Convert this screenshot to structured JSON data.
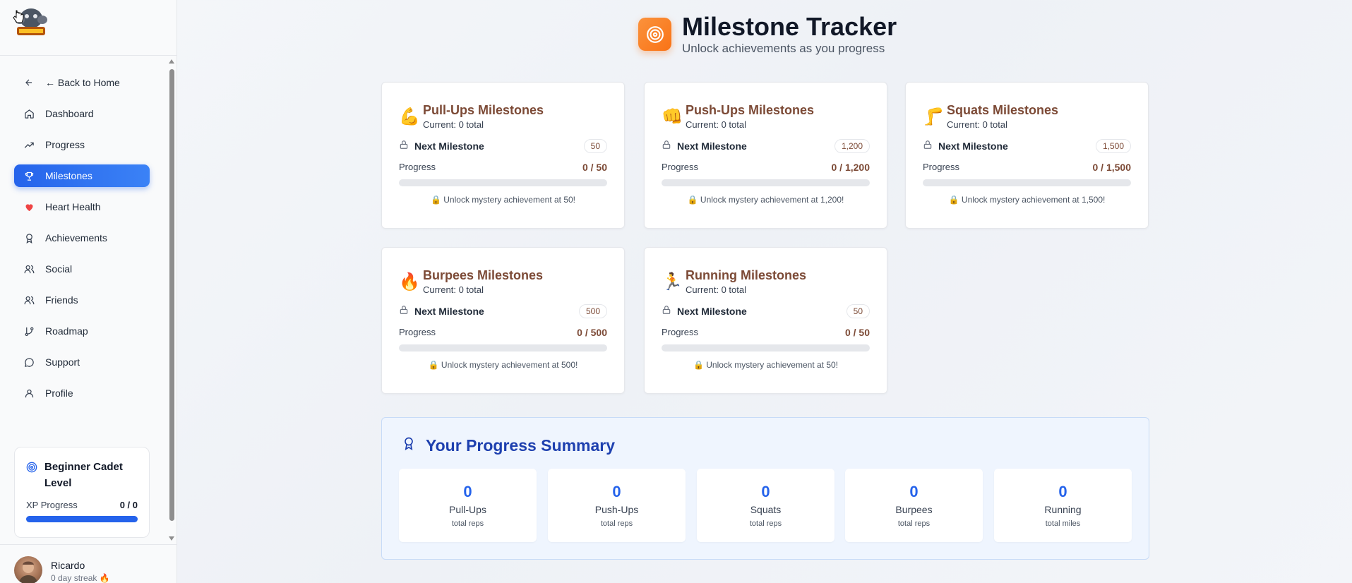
{
  "sidebar": {
    "items": [
      {
        "label": "← Back to Home",
        "icon": "arrow-left-icon"
      },
      {
        "label": "Dashboard",
        "icon": "home-icon"
      },
      {
        "label": "Progress",
        "icon": "trending-up-icon"
      },
      {
        "label": "Milestones",
        "icon": "trophy-icon"
      },
      {
        "label": "Heart Health",
        "icon": "heart-icon"
      },
      {
        "label": "Achievements",
        "icon": "award-icon"
      },
      {
        "label": "Social",
        "icon": "users-icon"
      },
      {
        "label": "Friends",
        "icon": "friends-icon"
      },
      {
        "label": "Roadmap",
        "icon": "git-branch-icon"
      },
      {
        "label": "Support",
        "icon": "message-circle-icon"
      },
      {
        "label": "Profile",
        "icon": "user-icon"
      }
    ],
    "active": "Milestones",
    "level": {
      "title": "Beginner Cadet Level",
      "xp_label": "XP Progress",
      "xp_value": "0 / 0"
    },
    "user": {
      "name": "Ricardo",
      "streak": "0 day streak 🔥"
    }
  },
  "header": {
    "title": "Milestone Tracker",
    "subtitle": "Unlock achievements as you progress"
  },
  "cards": [
    {
      "emoji": "💪",
      "title": "Pull-Ups Milestones",
      "current": "Current: 0 total",
      "next_label": "Next Milestone",
      "next_value": "50",
      "progress_label": "Progress",
      "progress_value": "0 / 50",
      "unlock": "🔒 Unlock mystery achievement at 50!"
    },
    {
      "emoji": "👊",
      "title": "Push-Ups Milestones",
      "current": "Current: 0 total",
      "next_label": "Next Milestone",
      "next_value": "1,200",
      "progress_label": "Progress",
      "progress_value": "0 / 1,200",
      "unlock": "🔒 Unlock mystery achievement at 1,200!"
    },
    {
      "emoji": "🦵",
      "title": "Squats Milestones",
      "current": "Current: 0 total",
      "next_label": "Next Milestone",
      "next_value": "1,500",
      "progress_label": "Progress",
      "progress_value": "0 / 1,500",
      "unlock": "🔒 Unlock mystery achievement at 1,500!"
    },
    {
      "emoji": "🔥",
      "title": "Burpees Milestones",
      "current": "Current: 0 total",
      "next_label": "Next Milestone",
      "next_value": "500",
      "progress_label": "Progress",
      "progress_value": "0 / 500",
      "unlock": "🔒 Unlock mystery achievement at 500!"
    },
    {
      "emoji": "🏃",
      "title": "Running Milestones",
      "current": "Current: 0 total",
      "next_label": "Next Milestone",
      "next_value": "50",
      "progress_label": "Progress",
      "progress_value": "0 / 50",
      "unlock": "🔒 Unlock mystery achievement at 50!"
    }
  ],
  "summary": {
    "title": "Your Progress Summary",
    "stats": [
      {
        "value": "0",
        "label": "Pull-Ups",
        "unit": "total reps"
      },
      {
        "value": "0",
        "label": "Push-Ups",
        "unit": "total reps"
      },
      {
        "value": "0",
        "label": "Squats",
        "unit": "total reps"
      },
      {
        "value": "0",
        "label": "Burpees",
        "unit": "total reps"
      },
      {
        "value": "0",
        "label": "Running",
        "unit": "total miles"
      }
    ]
  },
  "colors": {
    "accent": "#2563eb",
    "card_title": "#7c4a36",
    "header_icon": "#f97316"
  }
}
